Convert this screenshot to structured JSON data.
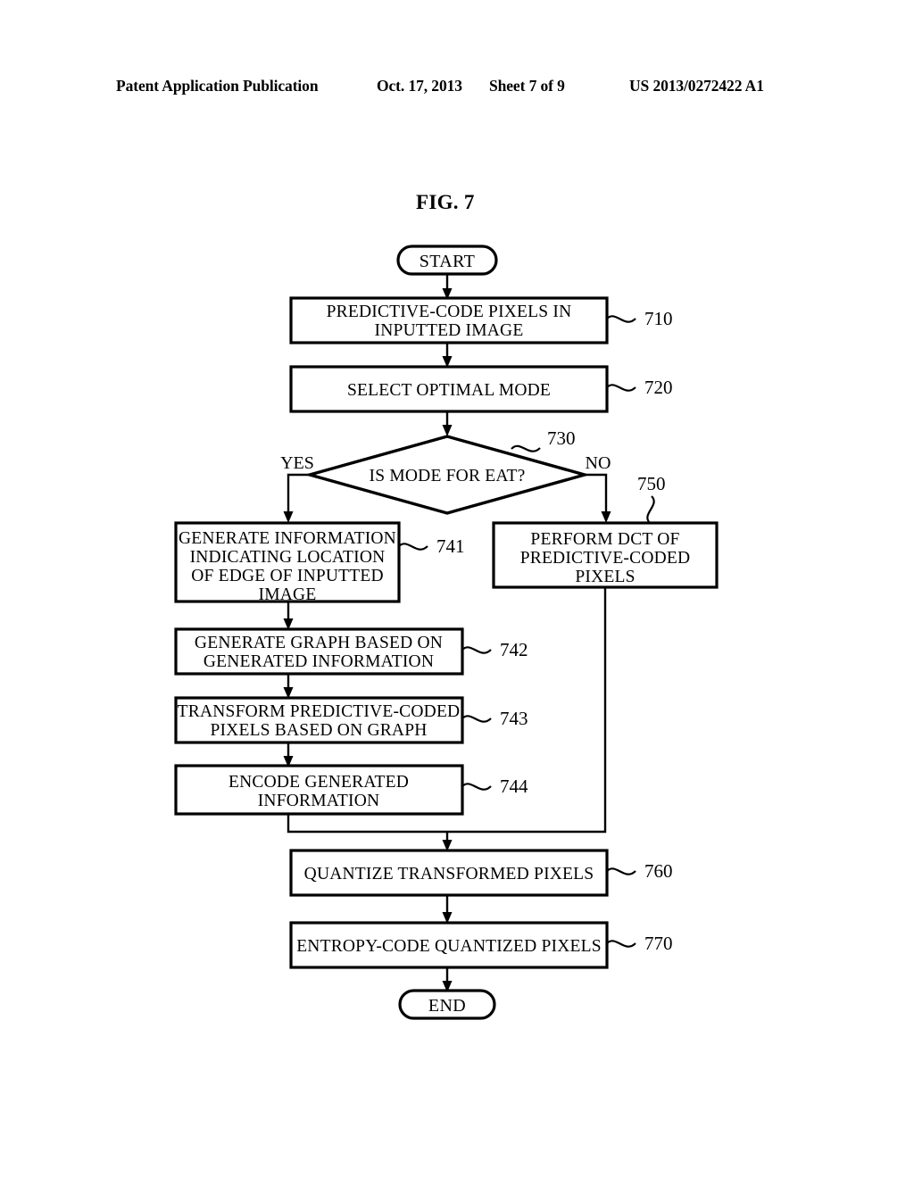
{
  "header": {
    "publication": "Patent Application Publication",
    "date": "Oct. 17, 2013",
    "sheet": "Sheet 7 of 9",
    "patent_number": "US 2013/0272422 A1"
  },
  "figure": {
    "title": "FIG. 7"
  },
  "flowchart": {
    "start_label": "START",
    "end_label": "END",
    "branch_yes": "YES",
    "branch_no": "NO",
    "decision": {
      "ref": "730",
      "text": "IS MODE FOR EAT?"
    },
    "steps": [
      {
        "ref": "710",
        "lines": [
          "PREDICTIVE-CODE PIXELS IN",
          "INPUTTED IMAGE"
        ]
      },
      {
        "ref": "720",
        "lines": [
          "SELECT OPTIMAL MODE"
        ]
      },
      {
        "ref": "741",
        "lines": [
          "GENERATE INFORMATION",
          "INDICATING LOCATION",
          "OF EDGE OF INPUTTED",
          "IMAGE"
        ]
      },
      {
        "ref": "750",
        "lines": [
          "PERFORM DCT OF",
          "PREDICTIVE-CODED",
          "PIXELS"
        ]
      },
      {
        "ref": "742",
        "lines": [
          "GENERATE GRAPH BASED ON",
          "GENERATED INFORMATION"
        ]
      },
      {
        "ref": "743",
        "lines": [
          "TRANSFORM PREDICTIVE-CODED",
          "PIXELS BASED ON GRAPH"
        ]
      },
      {
        "ref": "744",
        "lines": [
          "ENCODE GENERATED",
          "INFORMATION"
        ]
      },
      {
        "ref": "760",
        "lines": [
          "QUANTIZE TRANSFORMED PIXELS"
        ]
      },
      {
        "ref": "770",
        "lines": [
          "ENTROPY-CODE QUANTIZED PIXELS"
        ]
      }
    ]
  },
  "colors": {
    "ink": "#000000",
    "paper": "#ffffff"
  }
}
